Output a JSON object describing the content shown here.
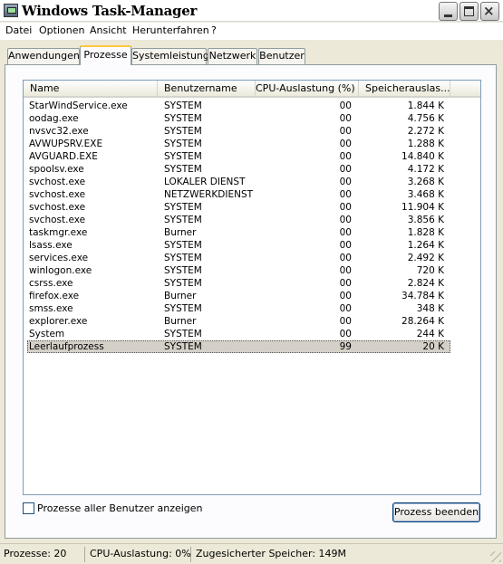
{
  "window": {
    "title": "Windows Task-Manager",
    "close_glyph": "×"
  },
  "menu": [
    "Datei",
    "Optionen",
    "Ansicht",
    "Herunterfahren",
    "?"
  ],
  "tabs": [
    "Anwendungen",
    "Prozesse",
    "Systemleistung",
    "Netzwerk",
    "Benutzer"
  ],
  "active_tab": "Prozesse",
  "table": {
    "columns": [
      "Name",
      "Benutzername",
      "CPU-Auslastung (%)",
      "Speicherauslas..."
    ],
    "rows": [
      {
        "name": "StarWindService.exe",
        "user": "SYSTEM",
        "cpu": "00",
        "mem": "1.844 K"
      },
      {
        "name": "oodag.exe",
        "user": "SYSTEM",
        "cpu": "00",
        "mem": "4.756 K"
      },
      {
        "name": "nvsvc32.exe",
        "user": "SYSTEM",
        "cpu": "00",
        "mem": "2.272 K"
      },
      {
        "name": "AVWUPSRV.EXE",
        "user": "SYSTEM",
        "cpu": "00",
        "mem": "1.288 K"
      },
      {
        "name": "AVGUARD.EXE",
        "user": "SYSTEM",
        "cpu": "00",
        "mem": "14.840 K"
      },
      {
        "name": "spoolsv.exe",
        "user": "SYSTEM",
        "cpu": "00",
        "mem": "4.172 K"
      },
      {
        "name": "svchost.exe",
        "user": "LOKALER DIENST",
        "cpu": "00",
        "mem": "3.268 K"
      },
      {
        "name": "svchost.exe",
        "user": "NETZWERKDIENST",
        "cpu": "00",
        "mem": "3.468 K"
      },
      {
        "name": "svchost.exe",
        "user": "SYSTEM",
        "cpu": "00",
        "mem": "11.904 K"
      },
      {
        "name": "svchost.exe",
        "user": "SYSTEM",
        "cpu": "00",
        "mem": "3.856 K"
      },
      {
        "name": "taskmgr.exe",
        "user": "Burner",
        "cpu": "00",
        "mem": "1.828 K"
      },
      {
        "name": "lsass.exe",
        "user": "SYSTEM",
        "cpu": "00",
        "mem": "1.264 K"
      },
      {
        "name": "services.exe",
        "user": "SYSTEM",
        "cpu": "00",
        "mem": "2.492 K"
      },
      {
        "name": "winlogon.exe",
        "user": "SYSTEM",
        "cpu": "00",
        "mem": "720 K"
      },
      {
        "name": "csrss.exe",
        "user": "SYSTEM",
        "cpu": "00",
        "mem": "2.824 K"
      },
      {
        "name": "firefox.exe",
        "user": "Burner",
        "cpu": "00",
        "mem": "34.784 K"
      },
      {
        "name": "smss.exe",
        "user": "SYSTEM",
        "cpu": "00",
        "mem": "348 K"
      },
      {
        "name": "explorer.exe",
        "user": "Burner",
        "cpu": "00",
        "mem": "28.264 K"
      },
      {
        "name": "System",
        "user": "SYSTEM",
        "cpu": "00",
        "mem": "244 K"
      },
      {
        "name": "Leerlaufprozess",
        "user": "SYSTEM",
        "cpu": "99",
        "mem": "20 K",
        "selected": true
      }
    ]
  },
  "show_all_users_label": "Prozesse aller Benutzer anzeigen",
  "show_all_users_checked": false,
  "end_process_label": "Prozess beenden",
  "status": {
    "processes": "Prozesse: 20",
    "cpu": "CPU-Auslastung: 0%",
    "commit": "Zugesicherter Speicher: 149M"
  },
  "colors": {
    "tab_highlight": "#ffc83c",
    "selection": "#d4d0c8",
    "window_face": "#ece9d8"
  }
}
